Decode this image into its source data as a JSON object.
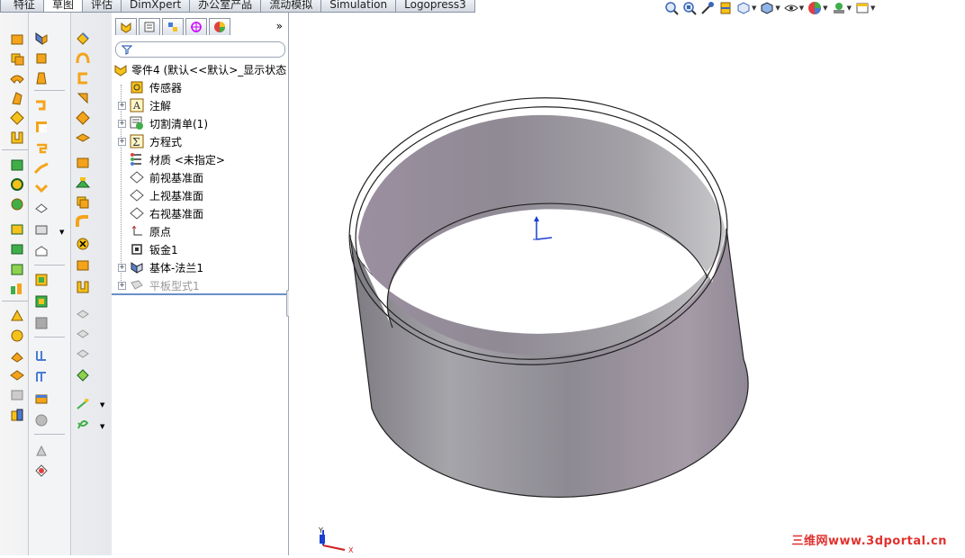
{
  "command_tabs": [
    "特征",
    "草图",
    "评估",
    "DimXpert",
    "办公室产品",
    "流动模拟",
    "Simulation",
    "Logopress3"
  ],
  "active_tab": "草图",
  "feature_tree": {
    "root": "零件4 (默认<<默认>_显示状态",
    "items": [
      {
        "label": "传感器",
        "icon": "sensor-icon",
        "expandable": false
      },
      {
        "label": "注解",
        "icon": "annotation-icon",
        "expandable": true
      },
      {
        "label": "切割清单(1)",
        "icon": "cut-list-icon",
        "expandable": true
      },
      {
        "label": "方程式",
        "icon": "equation-icon",
        "expandable": true
      },
      {
        "label": "材质 <未指定>",
        "icon": "material-icon",
        "expandable": false
      },
      {
        "label": "前视基准面",
        "icon": "plane-icon",
        "expandable": false
      },
      {
        "label": "上视基准面",
        "icon": "plane-icon",
        "expandable": false
      },
      {
        "label": "右视基准面",
        "icon": "plane-icon",
        "expandable": false
      },
      {
        "label": "原点",
        "icon": "origin-icon",
        "expandable": false
      },
      {
        "label": "钣金1",
        "icon": "sheetmetal-icon",
        "expandable": false
      },
      {
        "label": "基体-法兰1",
        "icon": "base-flange-icon",
        "expandable": true
      },
      {
        "label": "平板型式1",
        "icon": "flat-pattern-icon",
        "expandable": true,
        "suppressed": true
      }
    ]
  },
  "view_toolbar_icons": [
    "zoom-to-fit-icon",
    "zoom-area-icon",
    "previous-view-icon",
    "section-view-icon",
    "view-orientation-icon",
    "display-style-icon",
    "hide-show-icon",
    "appearance-icon",
    "scene-icon",
    "view-settings-icon"
  ],
  "triad": {
    "x": "X",
    "y": "Y"
  },
  "watermark": "三维网www.3dportal.cn",
  "colors": {
    "accent": "#6a8fc7",
    "part_surface": "#9b97a3",
    "watermark": "#e0322e"
  }
}
